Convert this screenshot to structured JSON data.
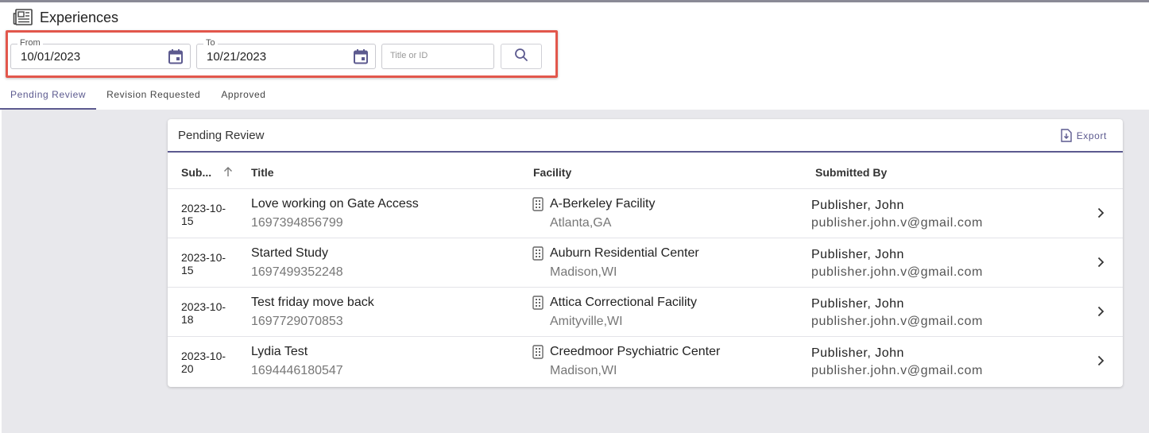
{
  "header": {
    "title": "Experiences",
    "icon": "newspaper-icon"
  },
  "filters": {
    "from": {
      "label": "From",
      "value": "10/01/2023"
    },
    "to": {
      "label": "To",
      "value": "10/21/2023"
    },
    "search": {
      "placeholder": "Title or ID"
    }
  },
  "tabs": [
    "Pending Review",
    "Revision Requested",
    "Approved"
  ],
  "active_tab": "Pending Review",
  "card": {
    "title": "Pending Review",
    "export_label": "Export",
    "columns": [
      "Sub...",
      "Title",
      "Facility",
      "Submitted By"
    ],
    "rows": [
      {
        "date": "2023-10-15",
        "date_line1": "2023-10-",
        "date_line2": "15",
        "title": "Love working on Gate Access",
        "id": "1697394856799",
        "facility": "A-Berkeley Facility",
        "location": "Atlanta,GA",
        "submitter": "Publisher, John",
        "email": "publisher.john.v@gmail.com"
      },
      {
        "date": "2023-10-15",
        "date_line1": "2023-10-",
        "date_line2": "15",
        "title": "Started Study",
        "id": "1697499352248",
        "facility": "Auburn Residential Center",
        "location": "Madison,WI",
        "submitter": "Publisher, John",
        "email": "publisher.john.v@gmail.com"
      },
      {
        "date": "2023-10-18",
        "date_line1": "2023-10-",
        "date_line2": "18",
        "title": "Test friday move back",
        "id": "1697729070853",
        "facility": "Attica Correctional Facility",
        "location": "Amityville,WI",
        "submitter": "Publisher, John",
        "email": "publisher.john.v@gmail.com"
      },
      {
        "date": "2023-10-20",
        "date_line1": "2023-10-",
        "date_line2": "20",
        "title": "Lydia Test",
        "id": "1694446180547",
        "facility": "Creedmoor Psychiatric Center",
        "location": "Madison,WI",
        "submitter": "Publisher, John",
        "email": "publisher.john.v@gmail.com"
      }
    ]
  },
  "colors": {
    "accent": "#5c5a8f",
    "highlight_border": "#e2574c",
    "background": "#e8e8ec"
  }
}
